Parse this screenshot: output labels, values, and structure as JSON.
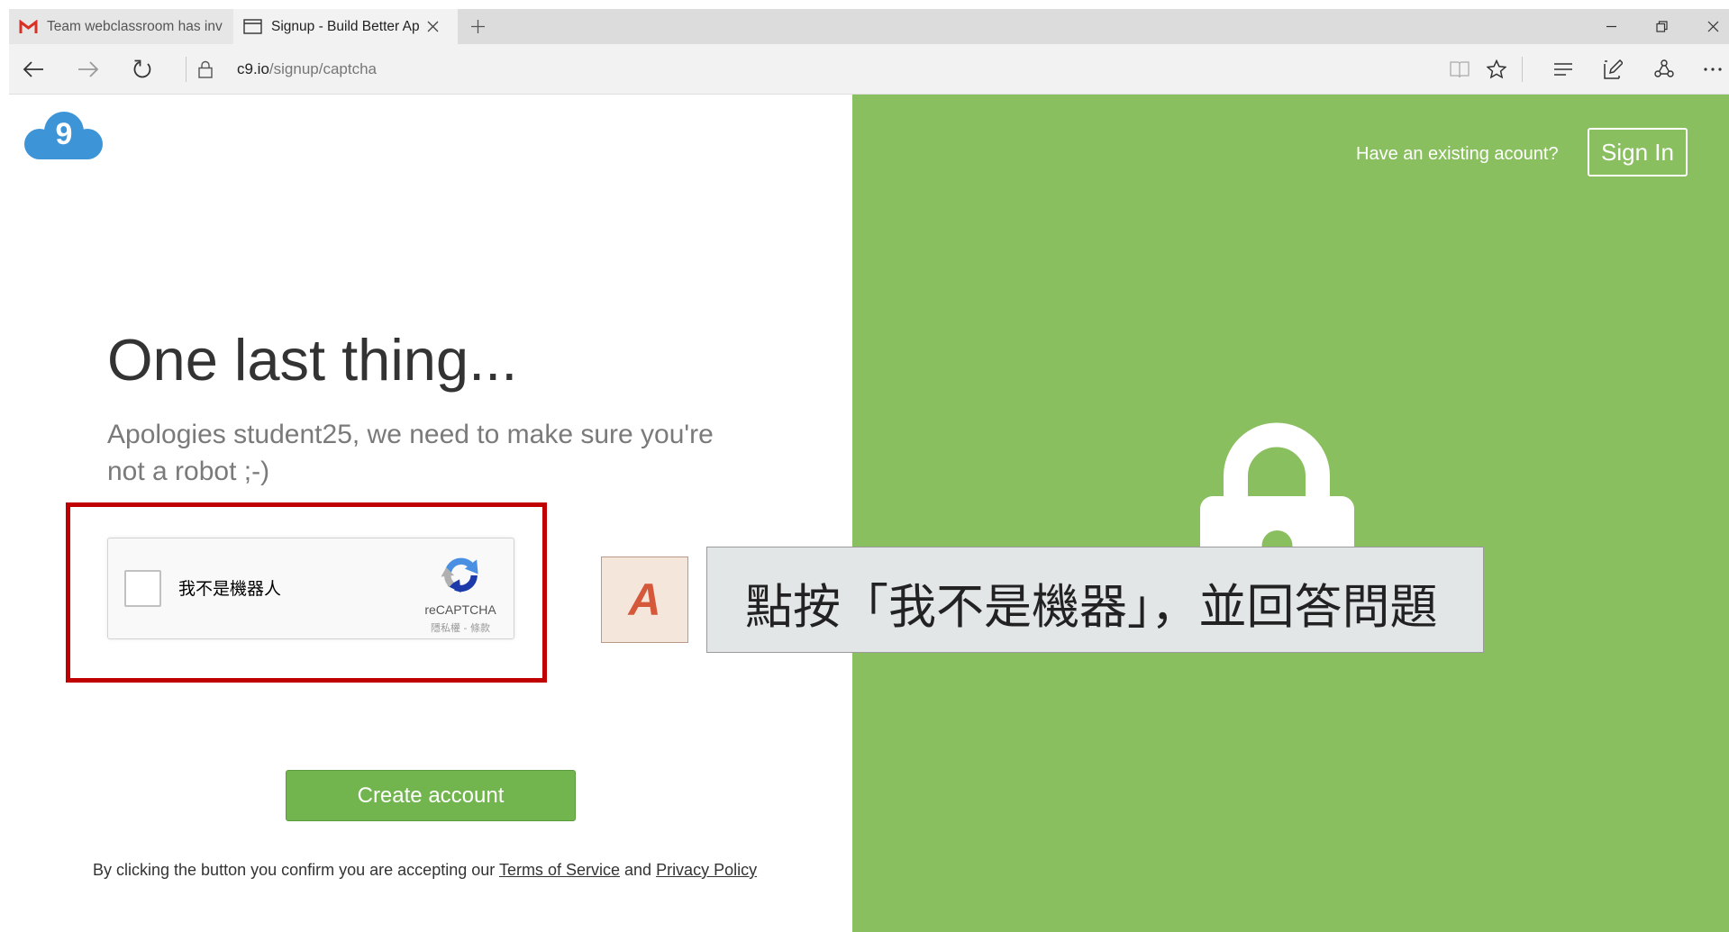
{
  "browser": {
    "tabs": [
      {
        "label": "Team webclassroom has inv",
        "icon": "gmail-icon"
      },
      {
        "label": "Signup - Build Better Ap",
        "icon": "page-icon"
      }
    ],
    "address": {
      "host": "c9.io",
      "path": "/signup/captcha"
    }
  },
  "logo": {
    "mark": "9"
  },
  "header": {
    "existing_prompt": "Have an existing acount?",
    "sign_in_label": "Sign In"
  },
  "main": {
    "title": "One last thing...",
    "message": "Apologies student25, we need to make sure you're not a robot ;-)",
    "captcha": {
      "checkbox_label": "我不是機器人",
      "brand": "reCAPTCHA",
      "links": "隱私權 - 條款"
    },
    "create_label": "Create account",
    "footer": {
      "prefix": "By clicking the button you confirm you are accepting our",
      "terms": "Terms of Service",
      "joiner": "and",
      "privacy": "Privacy Policy"
    }
  },
  "annotation": {
    "marker": "A",
    "caption": "點按「我不是機器」，並回答問題"
  },
  "colors": {
    "panel_green": "#89bf5e",
    "button_green": "#72b54f",
    "highlight_red": "#c00000",
    "logo_blue": "#3d95d8"
  }
}
